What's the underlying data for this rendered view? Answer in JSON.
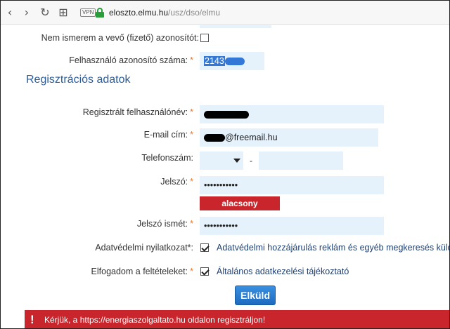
{
  "browser": {
    "back_glyph": "‹",
    "forward_glyph": "›",
    "reload_glyph": "↻",
    "grid_glyph": "⊞",
    "vpn_label": "VPN",
    "url_host": "eloszto.elmu.hu",
    "url_path": "/usz/dso/elmu"
  },
  "form": {
    "unknown_buyer_label": "Nem ismerem a vevő (fizető) azonosítót:",
    "user_id_label": "Felhasználó azonosító száma:",
    "user_id_value": "2143",
    "section_title": "Regisztrációs adatok",
    "username_label": "Regisztrált felhasználónév:",
    "email_label": "E-mail cím:",
    "email_value": "@freemail.hu",
    "phone_label": "Telefonszám:",
    "phone_separator": "-",
    "password_label": "Jelszó:",
    "password_value": "•••••••••••",
    "strength_label": "alacsony",
    "password_again_label": "Jelszó ismét:",
    "password_again_value": "•••••••••••",
    "privacy_label": "Adatvédelmi nyilatkozat*:",
    "privacy_text": "Adatvédelmi hozzájárulás reklám és egyéb megkeresés küldéséhez",
    "terms_label": "Elfogadom a feltételeket:",
    "terms_text": "Általános adatkezelési tájékoztató",
    "required_mark": "*",
    "submit_label": "Elküld"
  },
  "alert": {
    "icon": "!",
    "message": "Kérjük, a https://energiaszolgaltato.hu oldalon regisztráljon!"
  },
  "colors": {
    "accent": "#2a5d9c",
    "required": "#e8782c",
    "error": "#c8262c",
    "input_bg": "#e6f2fb"
  }
}
